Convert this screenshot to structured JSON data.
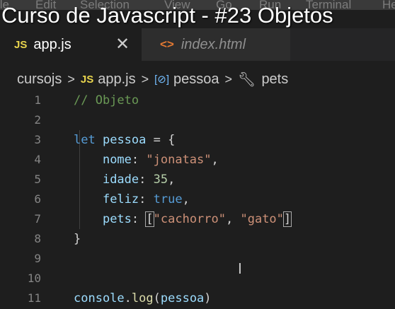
{
  "menubar": {
    "items": [
      "ile",
      "Edit",
      "Selection",
      "View",
      "Go",
      "Run",
      "Terminal",
      "Help"
    ]
  },
  "video_title": "Curso de Javascript - #23 Objetos",
  "tabs": [
    {
      "icon": "JS",
      "label": "app.js",
      "active": true
    },
    {
      "icon": "<>",
      "label": "index.html",
      "active": false
    }
  ],
  "breadcrumb": {
    "folder": "cursojs",
    "file": "app.js",
    "object": "pessoa",
    "property": "pets",
    "icons": {
      "file": "JS",
      "object": "[⊘]",
      "property": "wrench-icon"
    }
  },
  "code_lines": [
    {
      "n": "1",
      "tokens": [
        {
          "t": "// Objeto",
          "c": "cmt"
        }
      ]
    },
    {
      "n": "2",
      "tokens": []
    },
    {
      "n": "3",
      "tokens": [
        {
          "t": "let",
          "c": "kw"
        },
        {
          "t": " "
        },
        {
          "t": "pessoa",
          "c": "var"
        },
        {
          "t": " = {"
        }
      ]
    },
    {
      "n": "4",
      "tokens": [
        {
          "t": "    "
        },
        {
          "t": "nome",
          "c": "var"
        },
        {
          "t": ": "
        },
        {
          "t": "\"jonatas\"",
          "c": "str"
        },
        {
          "t": ","
        }
      ]
    },
    {
      "n": "5",
      "tokens": [
        {
          "t": "    "
        },
        {
          "t": "idade",
          "c": "var"
        },
        {
          "t": ": "
        },
        {
          "t": "35",
          "c": "num"
        },
        {
          "t": ","
        }
      ]
    },
    {
      "n": "6",
      "tokens": [
        {
          "t": "    "
        },
        {
          "t": "feliz",
          "c": "var"
        },
        {
          "t": ": "
        },
        {
          "t": "true",
          "c": "kw"
        },
        {
          "t": ","
        }
      ]
    },
    {
      "n": "7",
      "tokens": [
        {
          "t": "    "
        },
        {
          "t": "pets",
          "c": "var"
        },
        {
          "t": ": "
        },
        {
          "t": "[",
          "c": "bracket-match"
        },
        {
          "t": "\"cachorro\"",
          "c": "str"
        },
        {
          "t": ", "
        },
        {
          "t": "\"gato\"",
          "c": "str"
        },
        {
          "t": "]",
          "c": "bracket-match"
        }
      ]
    },
    {
      "n": "8",
      "tokens": [
        {
          "t": "}"
        }
      ]
    },
    {
      "n": "9",
      "tokens": []
    },
    {
      "n": "10",
      "tokens": []
    },
    {
      "n": "11",
      "tokens": [
        {
          "t": "console",
          "c": "var"
        },
        {
          "t": "."
        },
        {
          "t": "log",
          "c": "fn"
        },
        {
          "t": "("
        },
        {
          "t": "pessoa",
          "c": "var"
        },
        {
          "t": ")"
        }
      ]
    }
  ],
  "colors": {
    "editor_bg": "#1e1e1e",
    "keyword": "#569cd6",
    "variable": "#9cdcfe",
    "string": "#ce9178",
    "number": "#b5cea8",
    "comment": "#6a9955",
    "function": "#dcdcaa",
    "js_icon": "#e8d44d"
  }
}
